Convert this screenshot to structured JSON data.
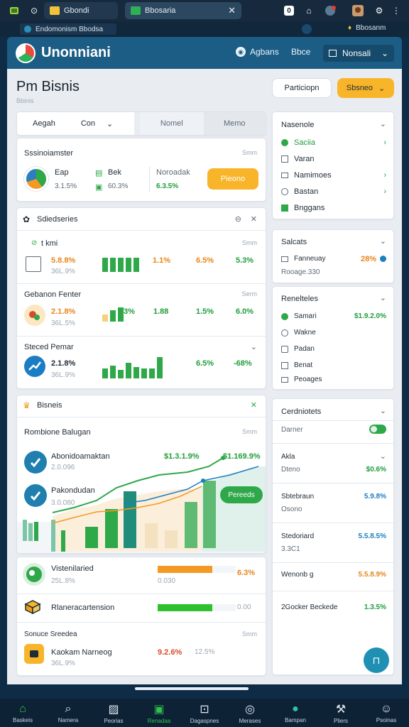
{
  "browser": {
    "tabs": [
      {
        "label": "Gbondi"
      },
      {
        "label": "Bbosaria"
      }
    ],
    "url_label": "Endomonism Bbodsa",
    "right_label": "Bbosanm"
  },
  "header": {
    "brand": "Unonniani",
    "nav1": "Agbans",
    "nav2": "Bbce",
    "nav3": "Nonsali"
  },
  "page": {
    "title": "Pm Bisnis",
    "subtitle": "Bbinis",
    "btn_outline": "Particiopn",
    "btn_primary": "Sbsneo"
  },
  "tabs": {
    "t1": "Aegah",
    "t2": "Con",
    "t3": "Nomel",
    "t4": "Memo"
  },
  "summary": {
    "title": "Sssinoiamster",
    "corner": "Smm",
    "a_label": "Eap",
    "a_val": "3.1.5%",
    "b_label": "Bek",
    "b_val": "60.3%",
    "c_label": "Noroadak",
    "c_val": "6.3.5%",
    "button": "Pieono"
  },
  "sched": {
    "title": "Sdiedseries",
    "r1_label": "t kmi",
    "r1_corner": "Smm",
    "r1_pct": "5.8.8%",
    "r1_sub": "36L.9%",
    "r1_v1": "1.1%",
    "r1_v2": "6.5%",
    "r1_v3": "5.3%",
    "r2_title": "Gebanon Fenter",
    "r2_corner": "Serm",
    "r2_pct": "2.1.8%",
    "r2_sub": "36L.5%",
    "r2_v0": "3%",
    "r2_v1": "1.88",
    "r2_v2": "1.5%",
    "r2_v3": "6.0%",
    "r3_title": "Steced Pemar",
    "r3_pct": "2.1.8%",
    "r3_sub": "36L.9%",
    "r3_v2": "6.5%",
    "r3_v3": "-68%"
  },
  "bisnes": {
    "title": "Bisneis",
    "sub_title": "Rombione Balugan",
    "corner": "Smm",
    "item1": "Abonidoamaktan",
    "item1_sub": "2.0.096",
    "item2": "Pakondudan",
    "item2_sub": "3.0.080",
    "val1": "$1.3.1.9%",
    "val2": "$1.169.9%",
    "pill": "Pereeds"
  },
  "progress": {
    "r1": "Vistenilaried",
    "r1_sub": "25L.8%",
    "r1_mid": "0.030",
    "r1_val": "6.3%",
    "r1_fill": 0.7,
    "r2": "Rlaneracartension",
    "r2_val": "0.00",
    "r2_fill": 0.7,
    "r3_title": "Sonuce Sreedea",
    "r3_corner": "Smm",
    "r3": "Kaokam Narneog",
    "r3_sub": "36L.9%",
    "r3_v1": "9.2.6%",
    "r3_v2": "12.5%"
  },
  "side1": {
    "title": "Nasenole",
    "items": [
      "Saciia",
      "Varan",
      "Namimoes",
      "Bastan",
      "Bnggans"
    ]
  },
  "side2": {
    "title": "Salcats",
    "item": "Fanneuay",
    "item_sub": "Rooage.330",
    "val": "28%"
  },
  "side3": {
    "title": "Renelteles",
    "items": [
      "Samari",
      "Wakne",
      "Padan",
      "Benat",
      "Peoages"
    ],
    "val": "$1.9.2.0%"
  },
  "side4": {
    "title": "Cerdniotets",
    "toggle_label": "Darner",
    "rows": [
      {
        "a": "Akla",
        "b": "Dteno",
        "v": "$0.6%"
      },
      {
        "a": "Sbtebraun",
        "b": "Osono",
        "v": "5.9.8%"
      },
      {
        "a": "Stedoriard",
        "b": "3.3C1",
        "v": "5.5.8.5%"
      },
      {
        "a": "Wenonb g",
        "b": "",
        "v": "5.5.8.9%"
      },
      {
        "a": "2Gocker Beckede",
        "b": "",
        "v": "1.3.5%"
      }
    ]
  },
  "bottomnav": [
    "Baskeis",
    "Namera",
    "Peorias",
    "Renadaa",
    "Dagaspnes",
    "Merases",
    "Bampan",
    "Pliers",
    "Psoinas"
  ]
}
